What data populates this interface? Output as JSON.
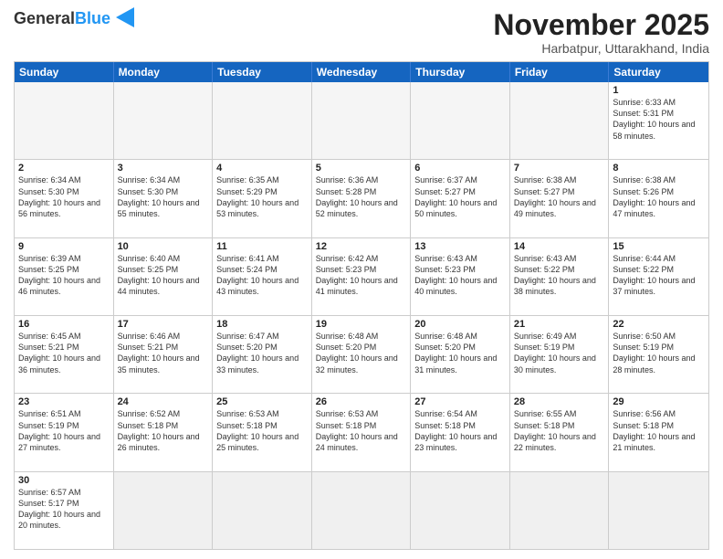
{
  "header": {
    "logo_general": "General",
    "logo_blue": "Blue",
    "month": "November 2025",
    "location": "Harbatpur, Uttarakhand, India"
  },
  "weekdays": [
    "Sunday",
    "Monday",
    "Tuesday",
    "Wednesday",
    "Thursday",
    "Friday",
    "Saturday"
  ],
  "rows": [
    [
      {
        "day": "",
        "info": ""
      },
      {
        "day": "",
        "info": ""
      },
      {
        "day": "",
        "info": ""
      },
      {
        "day": "",
        "info": ""
      },
      {
        "day": "",
        "info": ""
      },
      {
        "day": "",
        "info": ""
      },
      {
        "day": "1",
        "info": "Sunrise: 6:33 AM\nSunset: 5:31 PM\nDaylight: 10 hours and 58 minutes."
      }
    ],
    [
      {
        "day": "2",
        "info": "Sunrise: 6:34 AM\nSunset: 5:30 PM\nDaylight: 10 hours and 56 minutes."
      },
      {
        "day": "3",
        "info": "Sunrise: 6:34 AM\nSunset: 5:30 PM\nDaylight: 10 hours and 55 minutes."
      },
      {
        "day": "4",
        "info": "Sunrise: 6:35 AM\nSunset: 5:29 PM\nDaylight: 10 hours and 53 minutes."
      },
      {
        "day": "5",
        "info": "Sunrise: 6:36 AM\nSunset: 5:28 PM\nDaylight: 10 hours and 52 minutes."
      },
      {
        "day": "6",
        "info": "Sunrise: 6:37 AM\nSunset: 5:27 PM\nDaylight: 10 hours and 50 minutes."
      },
      {
        "day": "7",
        "info": "Sunrise: 6:38 AM\nSunset: 5:27 PM\nDaylight: 10 hours and 49 minutes."
      },
      {
        "day": "8",
        "info": "Sunrise: 6:38 AM\nSunset: 5:26 PM\nDaylight: 10 hours and 47 minutes."
      }
    ],
    [
      {
        "day": "9",
        "info": "Sunrise: 6:39 AM\nSunset: 5:25 PM\nDaylight: 10 hours and 46 minutes."
      },
      {
        "day": "10",
        "info": "Sunrise: 6:40 AM\nSunset: 5:25 PM\nDaylight: 10 hours and 44 minutes."
      },
      {
        "day": "11",
        "info": "Sunrise: 6:41 AM\nSunset: 5:24 PM\nDaylight: 10 hours and 43 minutes."
      },
      {
        "day": "12",
        "info": "Sunrise: 6:42 AM\nSunset: 5:23 PM\nDaylight: 10 hours and 41 minutes."
      },
      {
        "day": "13",
        "info": "Sunrise: 6:43 AM\nSunset: 5:23 PM\nDaylight: 10 hours and 40 minutes."
      },
      {
        "day": "14",
        "info": "Sunrise: 6:43 AM\nSunset: 5:22 PM\nDaylight: 10 hours and 38 minutes."
      },
      {
        "day": "15",
        "info": "Sunrise: 6:44 AM\nSunset: 5:22 PM\nDaylight: 10 hours and 37 minutes."
      }
    ],
    [
      {
        "day": "16",
        "info": "Sunrise: 6:45 AM\nSunset: 5:21 PM\nDaylight: 10 hours and 36 minutes."
      },
      {
        "day": "17",
        "info": "Sunrise: 6:46 AM\nSunset: 5:21 PM\nDaylight: 10 hours and 35 minutes."
      },
      {
        "day": "18",
        "info": "Sunrise: 6:47 AM\nSunset: 5:20 PM\nDaylight: 10 hours and 33 minutes."
      },
      {
        "day": "19",
        "info": "Sunrise: 6:48 AM\nSunset: 5:20 PM\nDaylight: 10 hours and 32 minutes."
      },
      {
        "day": "20",
        "info": "Sunrise: 6:48 AM\nSunset: 5:20 PM\nDaylight: 10 hours and 31 minutes."
      },
      {
        "day": "21",
        "info": "Sunrise: 6:49 AM\nSunset: 5:19 PM\nDaylight: 10 hours and 30 minutes."
      },
      {
        "day": "22",
        "info": "Sunrise: 6:50 AM\nSunset: 5:19 PM\nDaylight: 10 hours and 28 minutes."
      }
    ],
    [
      {
        "day": "23",
        "info": "Sunrise: 6:51 AM\nSunset: 5:19 PM\nDaylight: 10 hours and 27 minutes."
      },
      {
        "day": "24",
        "info": "Sunrise: 6:52 AM\nSunset: 5:18 PM\nDaylight: 10 hours and 26 minutes."
      },
      {
        "day": "25",
        "info": "Sunrise: 6:53 AM\nSunset: 5:18 PM\nDaylight: 10 hours and 25 minutes."
      },
      {
        "day": "26",
        "info": "Sunrise: 6:53 AM\nSunset: 5:18 PM\nDaylight: 10 hours and 24 minutes."
      },
      {
        "day": "27",
        "info": "Sunrise: 6:54 AM\nSunset: 5:18 PM\nDaylight: 10 hours and 23 minutes."
      },
      {
        "day": "28",
        "info": "Sunrise: 6:55 AM\nSunset: 5:18 PM\nDaylight: 10 hours and 22 minutes."
      },
      {
        "day": "29",
        "info": "Sunrise: 6:56 AM\nSunset: 5:18 PM\nDaylight: 10 hours and 21 minutes."
      }
    ],
    [
      {
        "day": "30",
        "info": "Sunrise: 6:57 AM\nSunset: 5:17 PM\nDaylight: 10 hours and 20 minutes."
      },
      {
        "day": "",
        "info": ""
      },
      {
        "day": "",
        "info": ""
      },
      {
        "day": "",
        "info": ""
      },
      {
        "day": "",
        "info": ""
      },
      {
        "day": "",
        "info": ""
      },
      {
        "day": "",
        "info": ""
      }
    ]
  ]
}
